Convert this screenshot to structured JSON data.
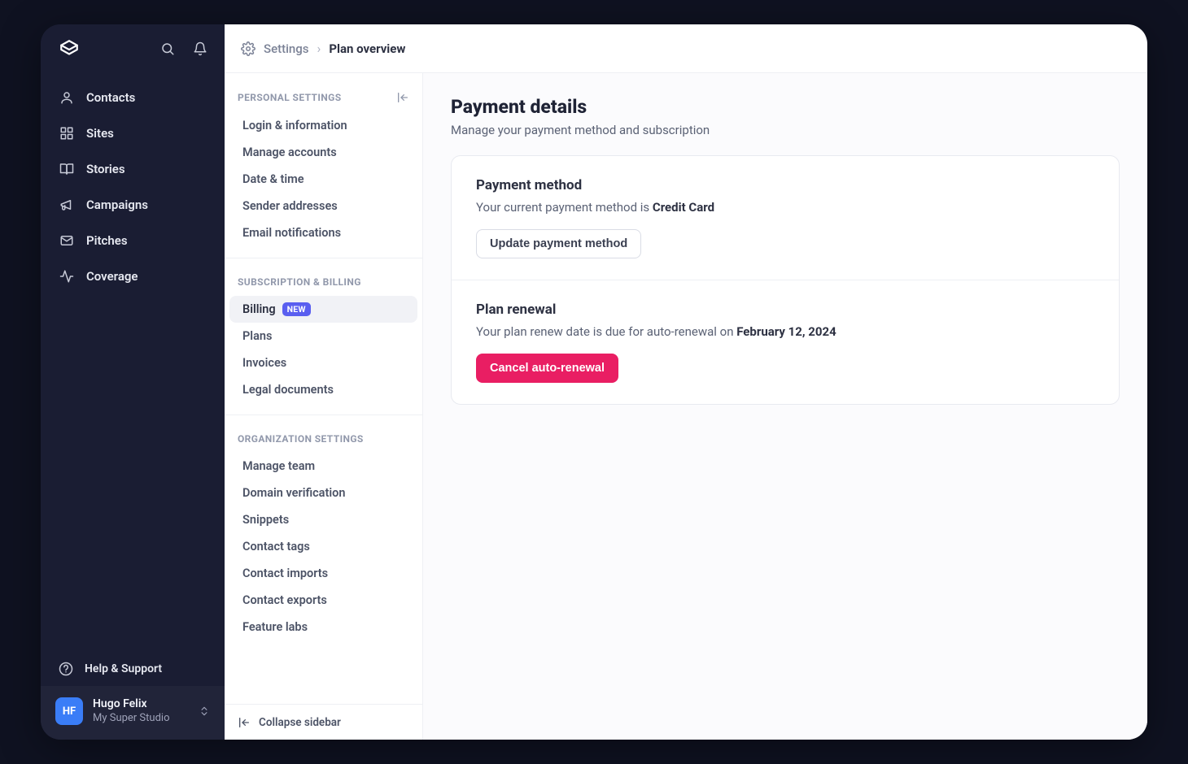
{
  "primary_nav": {
    "items": [
      {
        "label": "Contacts"
      },
      {
        "label": "Sites"
      },
      {
        "label": "Stories"
      },
      {
        "label": "Campaigns"
      },
      {
        "label": "Pitches"
      },
      {
        "label": "Coverage"
      }
    ],
    "help_label": "Help & Support"
  },
  "user": {
    "initials": "HF",
    "name": "Hugo Felix",
    "org": "My Super Studio"
  },
  "breadcrumb": {
    "root": "Settings",
    "current": "Plan overview"
  },
  "settings_sidebar": {
    "sections": [
      {
        "title": "PERSONAL SETTINGS",
        "items": [
          {
            "label": "Login & information"
          },
          {
            "label": "Manage accounts"
          },
          {
            "label": "Date & time"
          },
          {
            "label": "Sender addresses"
          },
          {
            "label": "Email notifications"
          }
        ]
      },
      {
        "title": "SUBSCRIPTION & BILLING",
        "items": [
          {
            "label": "Billing",
            "badge": "NEW",
            "active": true
          },
          {
            "label": "Plans"
          },
          {
            "label": "Invoices"
          },
          {
            "label": "Legal documents"
          }
        ]
      },
      {
        "title": "ORGANIZATION SETTINGS",
        "items": [
          {
            "label": "Manage team"
          },
          {
            "label": "Domain verification"
          },
          {
            "label": "Snippets"
          },
          {
            "label": "Contact tags"
          },
          {
            "label": "Contact imports"
          },
          {
            "label": "Contact exports"
          },
          {
            "label": "Feature labs"
          }
        ]
      }
    ],
    "collapse_label": "Collapse sidebar"
  },
  "page": {
    "title": "Payment details",
    "subtitle": "Manage your payment method and subscription",
    "payment_method": {
      "heading": "Payment method",
      "text_prefix": "Your current payment method is ",
      "value": "Credit Card",
      "button": "Update payment method"
    },
    "plan_renewal": {
      "heading": "Plan renewal",
      "text_prefix": "Your plan renew date is due for auto-renewal on ",
      "date": "February 12, 2024",
      "button": "Cancel auto-renewal"
    }
  }
}
